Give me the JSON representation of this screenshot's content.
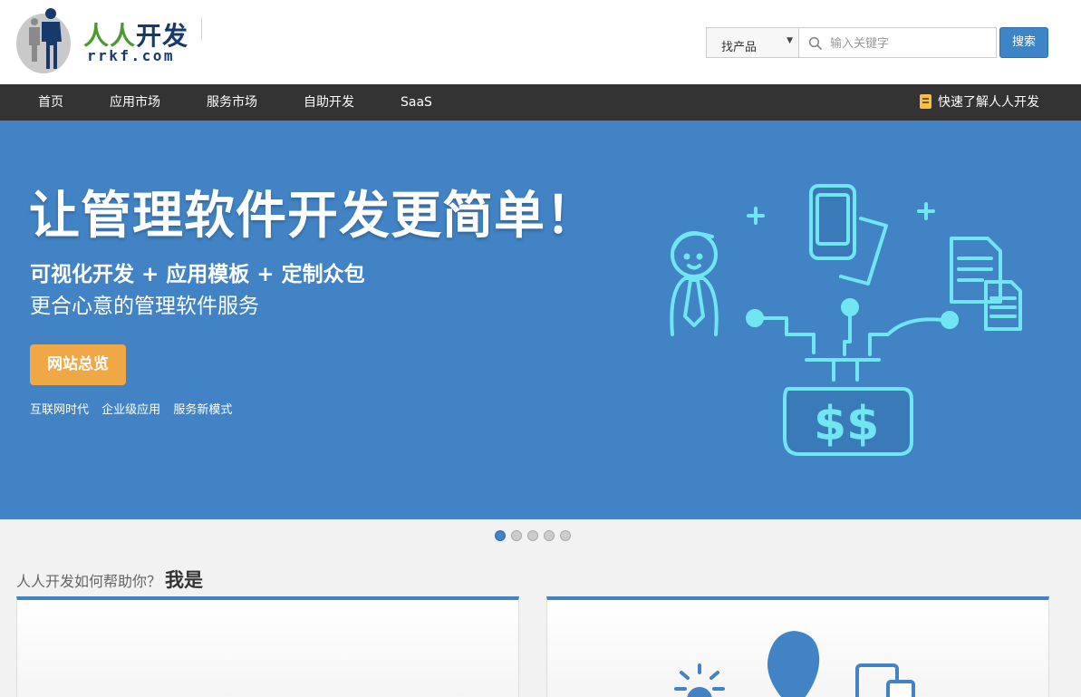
{
  "header": {
    "logo_cn_green": "人人",
    "logo_cn_blue": "开发",
    "logo_en": "rrkf.com"
  },
  "search": {
    "select_value": "找产品",
    "placeholder": "输入关键字",
    "button": "搜索"
  },
  "nav": {
    "items": [
      {
        "label": "首页"
      },
      {
        "label": "应用市场"
      },
      {
        "label": "服务市场"
      },
      {
        "label": "自助开发"
      },
      {
        "label": "SaaS"
      }
    ],
    "right_label": "快速了解人人开发",
    "right_icon": "contact-book-icon"
  },
  "banner": {
    "title": "让管理软件开发更简单！",
    "subtitle1": "可视化开发 + 应用模板 + 定制众包",
    "subtitle2": "更合心意的管理软件服务",
    "button": "网站总览",
    "tags": [
      "互联网时代",
      "企业级应用",
      "服务新模式"
    ]
  },
  "carousel": {
    "count": 5,
    "active_index": 0
  },
  "section": {
    "lead": "人人开发如何帮助你？",
    "strong": "我是"
  },
  "colors": {
    "brand_blue": "#4183c4",
    "nav_bg": "#333333",
    "accent_orange": "#f0a847",
    "logo_green": "#4a9a2e",
    "logo_navy": "#163a6b",
    "art_cyan": "#6fe6f0"
  }
}
